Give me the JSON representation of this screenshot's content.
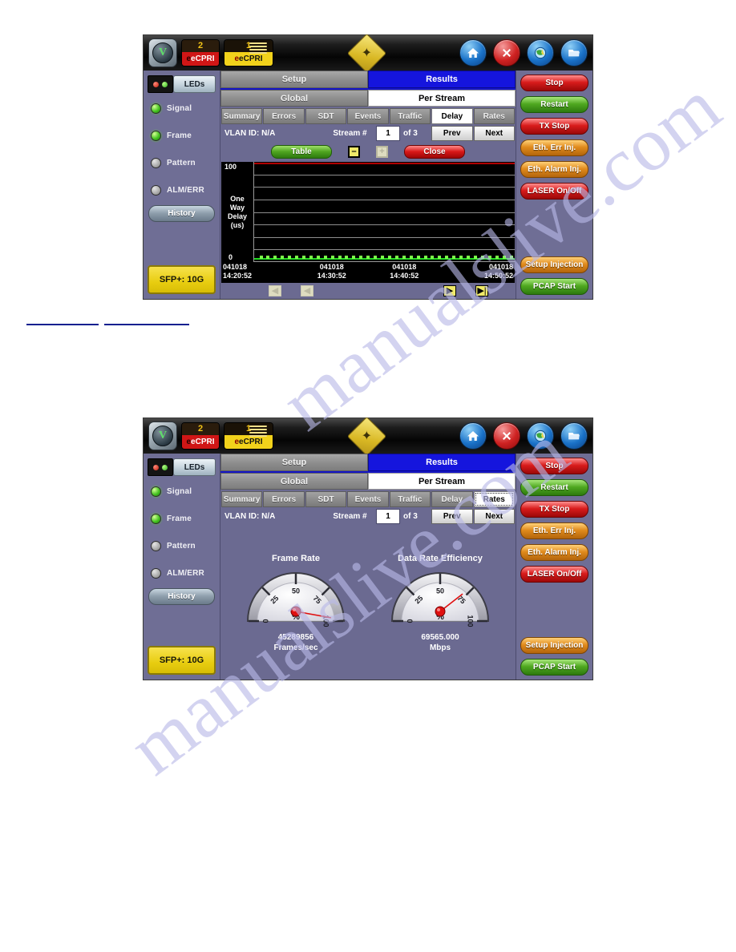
{
  "toolbar": {
    "logo_label": "V",
    "ports": [
      {
        "num": "2",
        "name": "eCPRI",
        "state": "inactive"
      },
      {
        "num": "1",
        "name": "eCPRI",
        "state": "active"
      }
    ],
    "icons": [
      "laser-diamond-icon",
      "home-icon",
      "close-icon",
      "globe-icon",
      "folder-icon"
    ]
  },
  "sidebar": {
    "leds_label": "LEDs",
    "leds": [
      {
        "label": "Signal",
        "state": "on"
      },
      {
        "label": "Frame",
        "state": "on"
      },
      {
        "label": "Pattern",
        "state": "off"
      },
      {
        "label": "ALM/ERR",
        "state": "off"
      }
    ],
    "history_label": "History",
    "sfp_label": "SFP+: 10G"
  },
  "rightbar": {
    "buttons": [
      {
        "label": "Stop",
        "color": "#d81c1c"
      },
      {
        "label": "Restart",
        "color": "#4fa820"
      },
      {
        "label": "TX Stop",
        "color": "#d81c1c"
      },
      {
        "label": "Eth. Err Inj.",
        "color": "#e08a1c"
      },
      {
        "label": "Eth. Alarm Inj.",
        "color": "#e08a1c"
      },
      {
        "label": "LASER On/Off",
        "color": "#d81c1c"
      }
    ],
    "bottom_buttons": [
      {
        "label": "Setup Injection",
        "color": "#e08a1c"
      },
      {
        "label": "PCAP Start",
        "color": "#4fa820"
      }
    ]
  },
  "panel1": {
    "top_tabs": [
      {
        "label": "Setup",
        "selected": false
      },
      {
        "label": "Results",
        "selected": true
      }
    ],
    "sub_tabs": [
      {
        "label": "Global",
        "selected": false
      },
      {
        "label": "Per Stream",
        "selected": true
      }
    ],
    "result_tabs": [
      {
        "label": "Summary",
        "selected": false
      },
      {
        "label": "Errors",
        "selected": false
      },
      {
        "label": "SDT",
        "selected": false
      },
      {
        "label": "Events",
        "selected": false
      },
      {
        "label": "Traffic",
        "selected": false
      },
      {
        "label": "Delay",
        "selected": true
      },
      {
        "label": "Rates",
        "selected": false
      }
    ],
    "infobar": {
      "vlan": "VLAN ID: N/A",
      "stream_label": "Stream #",
      "stream_value": "1",
      "stream_of": "of 3",
      "prev": "Prev",
      "next": "Next"
    },
    "actions": {
      "table": "Table",
      "minus": "–",
      "plus": "+",
      "close": "Close"
    },
    "nav": {
      "first_left": "◀",
      "left": "◀",
      "right": "▶",
      "last_right": "▶|"
    }
  },
  "panel2": {
    "top_tabs": [
      {
        "label": "Setup",
        "selected": false
      },
      {
        "label": "Results",
        "selected": true
      }
    ],
    "sub_tabs": [
      {
        "label": "Global",
        "selected": false
      },
      {
        "label": "Per Stream",
        "selected": true
      }
    ],
    "result_tabs": [
      {
        "label": "Summary",
        "selected": false
      },
      {
        "label": "Errors",
        "selected": false
      },
      {
        "label": "SDT",
        "selected": false
      },
      {
        "label": "Events",
        "selected": false
      },
      {
        "label": "Traffic",
        "selected": false
      },
      {
        "label": "Delay",
        "selected": false
      },
      {
        "label": "Rates",
        "selected": true
      }
    ],
    "infobar": {
      "vlan": "VLAN ID: N/A",
      "stream_label": "Stream #",
      "stream_value": "1",
      "stream_of": "of 3",
      "prev": "Prev",
      "next": "Next"
    }
  },
  "chart_data": [
    {
      "type": "line",
      "title": "One Way Delay",
      "ylabel": "One Way Delay (us)",
      "ylabel_lines": [
        "One",
        "Way",
        "Delay",
        "(us)"
      ],
      "ylim": [
        0,
        100
      ],
      "ytick_labels": [
        "100",
        "0"
      ],
      "gridlines": 7,
      "xlabel": "",
      "xtick_labels": [
        "041018\n14:20:52",
        "041018\n14:30:52",
        "041018\n14:40:52",
        "041018\n14:50:52"
      ],
      "xticks_date": [
        "041018",
        "041018",
        "041018",
        "041018"
      ],
      "xticks_time": [
        "14:20:52",
        "14:30:52",
        "14:40:52",
        "14:50:52"
      ],
      "series": [
        {
          "name": "One Way Delay",
          "color": "#1fd81f",
          "values": [
            0,
            0,
            0,
            0,
            0,
            0,
            0,
            0,
            0,
            0,
            0,
            0,
            0,
            0,
            0,
            0,
            0,
            0,
            0,
            0,
            0,
            0,
            0,
            0,
            0,
            0,
            0,
            0,
            0,
            0,
            0,
            0,
            0,
            0,
            0,
            0
          ]
        },
        {
          "name": "Threshold",
          "color": "#b00000",
          "values": [
            100
          ]
        }
      ],
      "background": "#000000",
      "grid": true,
      "legend": "none"
    },
    {
      "type": "gauge",
      "title": "Frame Rate",
      "value": 97,
      "display_value": "45289856",
      "unit": "Frames/sec",
      "axis_unit": "%",
      "ticks": [
        0,
        25,
        50,
        75,
        100
      ],
      "ylim": [
        0,
        100
      ],
      "needle_color": "#e01010"
    },
    {
      "type": "gauge",
      "title": "Data Rate Efficiency",
      "value": 72,
      "display_value": "69565.000",
      "unit": "Mbps",
      "axis_unit": "%",
      "ticks": [
        0,
        25,
        50,
        75,
        100
      ],
      "ylim": [
        0,
        100
      ],
      "needle_color": "#e01010"
    }
  ],
  "watermark": {
    "text_a": "manualslive.com",
    "text_b": "manualslive.com"
  }
}
